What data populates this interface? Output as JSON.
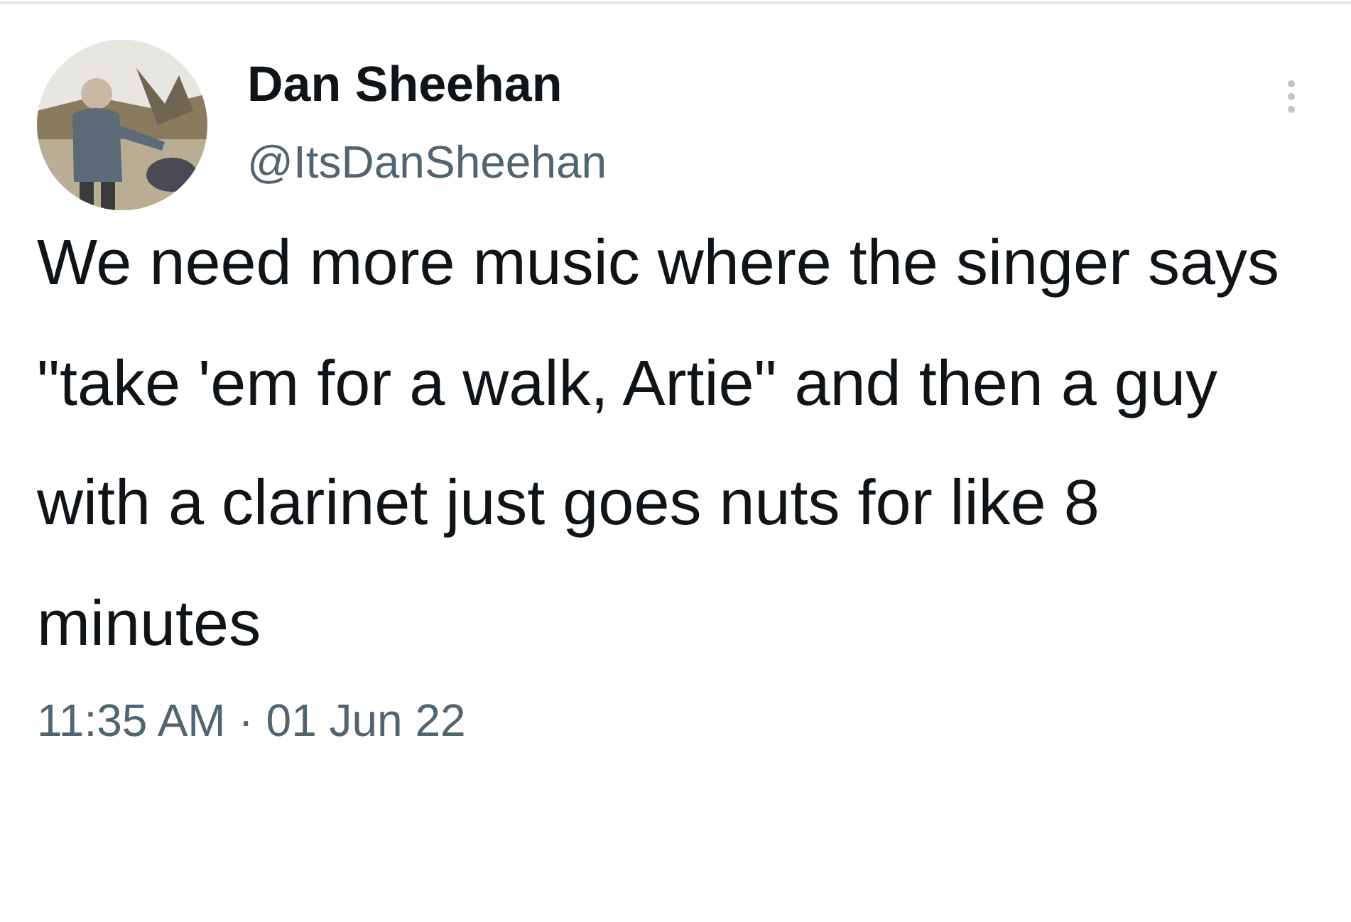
{
  "tweet": {
    "author": {
      "name": "Dan Sheehan",
      "handle": "@ItsDanSheehan"
    },
    "text": "We need more music where the singer says \"take 'em for a walk, Artie\" and then a guy with a clarinet just goes nuts for like 8 minutes",
    "timestamp": "11:35 AM · 01 Jun 22"
  }
}
